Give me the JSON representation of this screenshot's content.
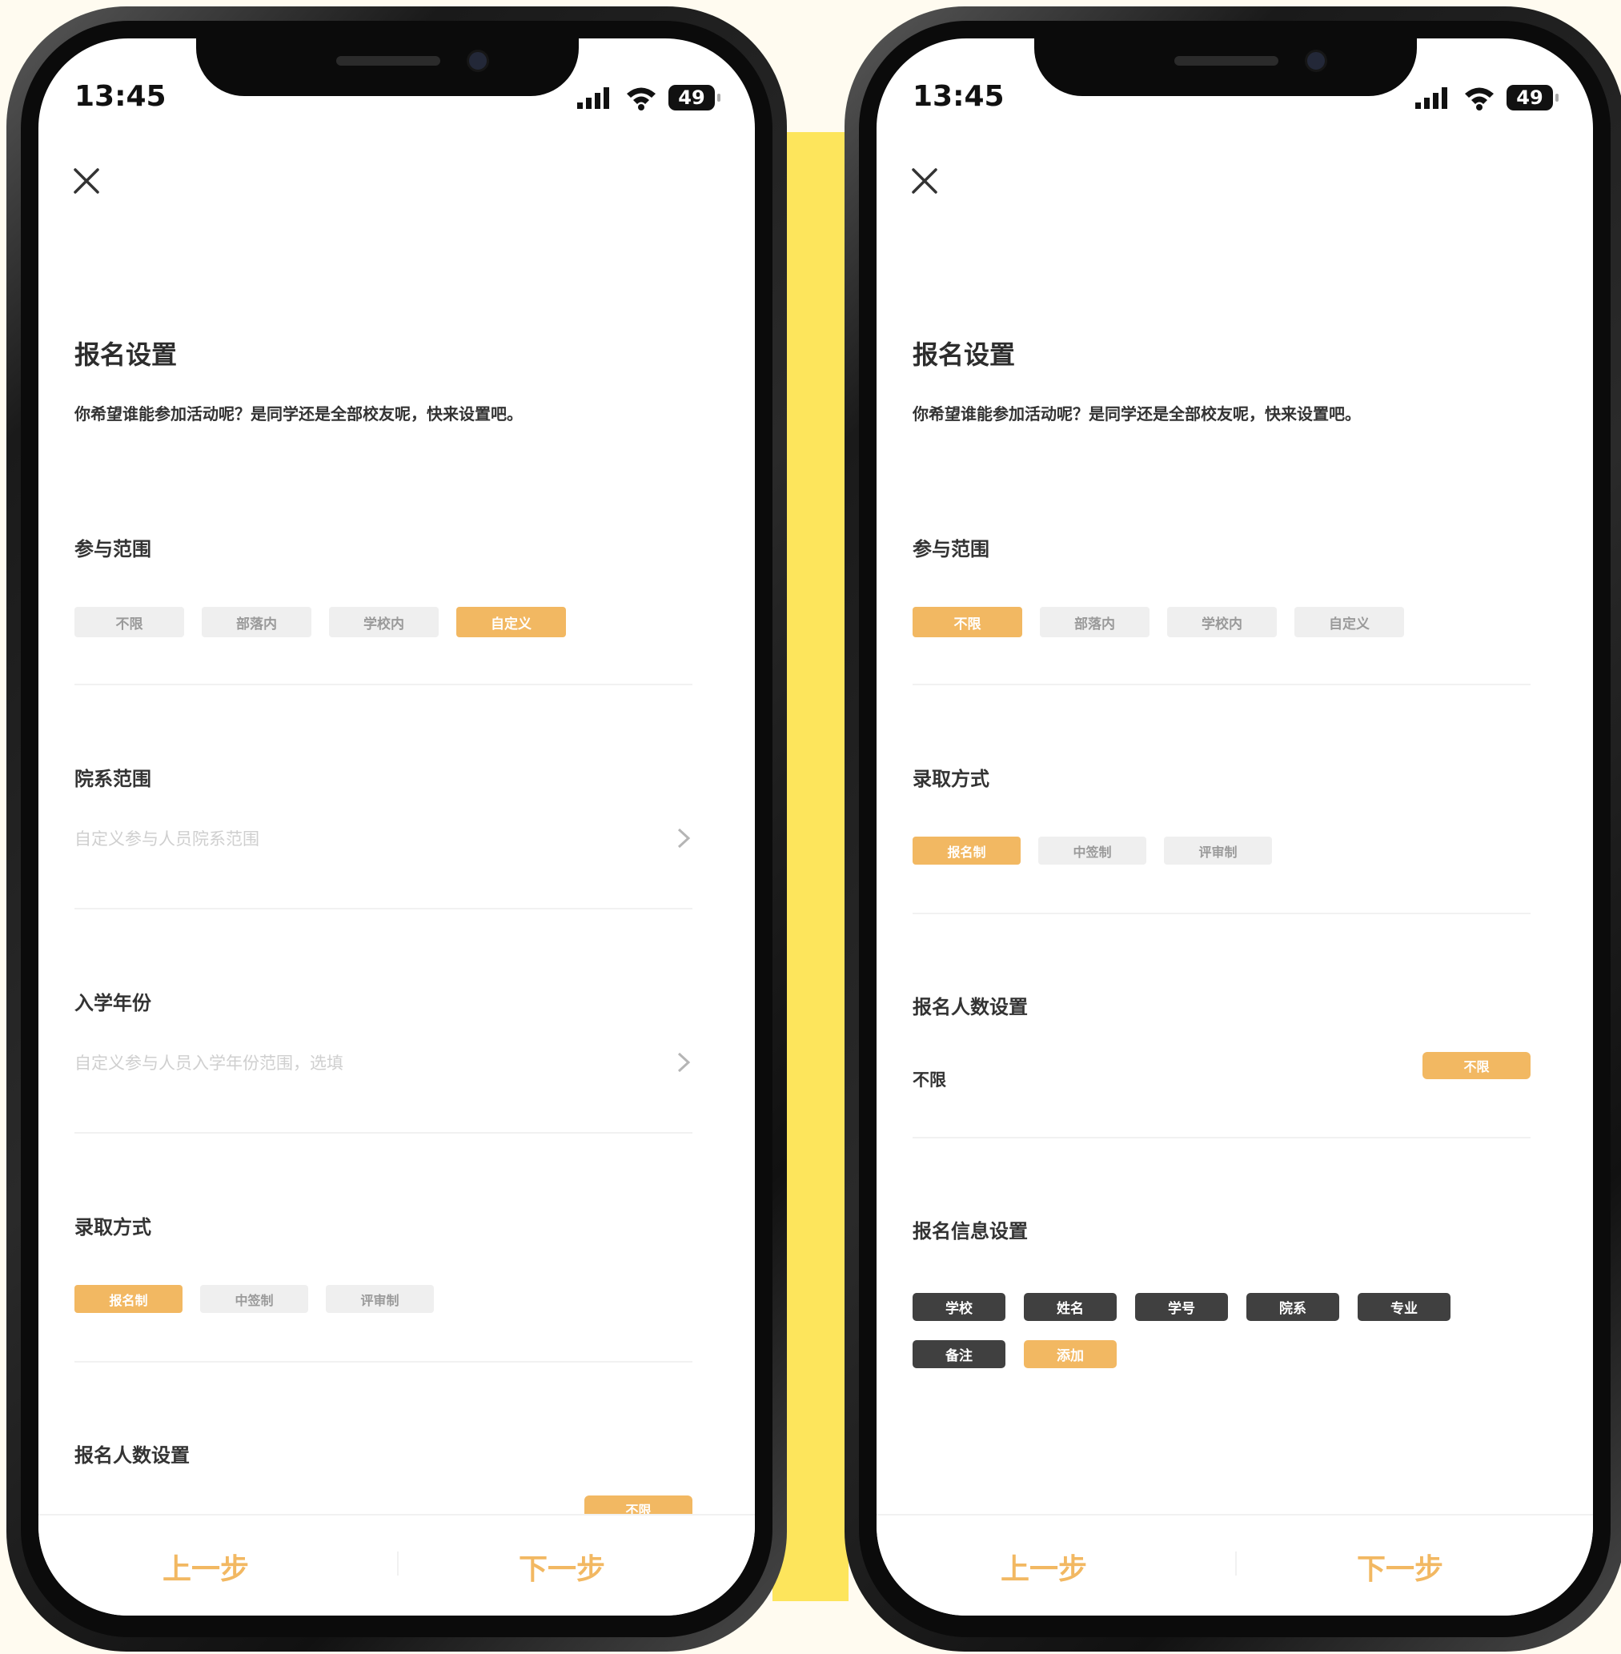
{
  "status": {
    "time": "13:45",
    "battery": "49"
  },
  "screen": {
    "title": "报名设置",
    "description": "你希望谁能参加活动呢？是同学还是全部校友呢，快来设置吧。"
  },
  "sections": {
    "participation_scope": "参与范围",
    "department_scope": "院系范围",
    "enrollment_year": "入学年份",
    "admission_method": "录取方式",
    "signup_count": "报名人数设置",
    "signup_info": "报名信息设置"
  },
  "scope_options": [
    "不限",
    "部落内",
    "学校内",
    "自定义"
  ],
  "admission_options": [
    "报名制",
    "中签制",
    "评审制"
  ],
  "department_placeholder": "自定义参与人员院系范围",
  "year_placeholder": "自定义参与人员入学年份范围，选填",
  "count": {
    "toggle_label": "不限",
    "row_label": "不限"
  },
  "info_tags": [
    "学校",
    "姓名",
    "学号",
    "院系",
    "专业",
    "备注"
  ],
  "info_add": "添加",
  "nav": {
    "prev": "上一步",
    "next": "下一步"
  },
  "left_selected_scope": "自定义",
  "right_selected_scope": "不限",
  "accent_color": "#f2b862"
}
